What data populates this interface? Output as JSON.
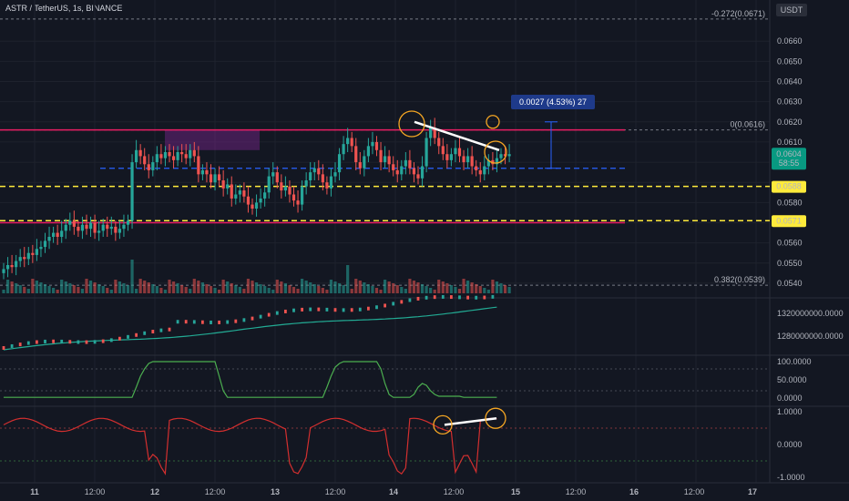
{
  "chart_data": {
    "type": "candlestick",
    "title": "ASTR / TetherUS, 1s, BINANCE",
    "currency": "USDT",
    "price_axis": {
      "ylim": [
        0.0535,
        0.0675
      ],
      "ticks": [
        "0.0660",
        "0.0650",
        "0.0640",
        "0.0630",
        "0.0620",
        "0.0610",
        "0.0580",
        "0.0560",
        "0.0550",
        "0.0540"
      ]
    },
    "current_price": {
      "value": "0.0604",
      "countdown": "58:55",
      "color": "#089981"
    },
    "price_labels": [
      {
        "value": "0.0588",
        "color": "#ffeb3b"
      },
      {
        "value": "0.0571",
        "color": "#ffeb3b"
      }
    ],
    "fib_labels": [
      "-0.272(0.0671)",
      "0(0.0616)",
      "0.382(0.0539)"
    ],
    "measure_label": "0.0027 (4.53%) 27",
    "x_axis": [
      "11",
      "12:00",
      "12",
      "12:00",
      "13",
      "12:00",
      "14",
      "12:00",
      "15",
      "12:00",
      "16",
      "12:00",
      "17"
    ],
    "indicator1": {
      "ticks": [
        "1320000000.0000",
        "1280000000.0000"
      ],
      "color": "#22ab94"
    },
    "indicator2": {
      "ticks": [
        "100.0000",
        "50.0000",
        "0.0000"
      ],
      "color": "#4caf50"
    },
    "indicator3": {
      "ticks": [
        "1.0000",
        "0.0000",
        "-1.0000"
      ],
      "color": "#d32f2f"
    },
    "colors": {
      "up": "#26a69a",
      "down": "#ef5350",
      "resistance": "#e91e63",
      "support": "#ffeb3b",
      "dashed": "#2962ff",
      "highlight": "#f5a623"
    },
    "candle_closes": [
      0.0547,
      0.0549,
      0.0548,
      0.0551,
      0.0553,
      0.0552,
      0.0555,
      0.0554,
      0.0557,
      0.0558,
      0.0561,
      0.0563,
      0.0565,
      0.0563,
      0.0566,
      0.0569,
      0.0571,
      0.0568,
      0.0566,
      0.0569,
      0.0567,
      0.057,
      0.0565,
      0.0566,
      0.0569,
      0.0567,
      0.0568,
      0.0565,
      0.0567,
      0.0569,
      0.0571,
      0.06,
      0.0606,
      0.0603,
      0.0599,
      0.0596,
      0.06,
      0.0604,
      0.0602,
      0.0605,
      0.0603,
      0.0601,
      0.0605,
      0.0604,
      0.0602,
      0.0606,
      0.0603,
      0.0594,
      0.0596,
      0.0594,
      0.059,
      0.0594,
      0.0591,
      0.0587,
      0.0589,
      0.0582,
      0.0584,
      0.0586,
      0.0583,
      0.0579,
      0.0577,
      0.058,
      0.0582,
      0.0585,
      0.0593,
      0.0595,
      0.059,
      0.0586,
      0.0588,
      0.0584,
      0.0581,
      0.0579,
      0.0588,
      0.0591,
      0.0595,
      0.0597,
      0.0594,
      0.059,
      0.0587,
      0.0593,
      0.0595,
      0.0604,
      0.0609,
      0.0612,
      0.0608,
      0.06,
      0.0597,
      0.0603,
      0.0608,
      0.061,
      0.0606,
      0.06,
      0.0603,
      0.0599,
      0.0596,
      0.0594,
      0.0598,
      0.0601,
      0.0597,
      0.0594,
      0.0592,
      0.0598,
      0.0612,
      0.0617,
      0.0612,
      0.0608,
      0.0604,
      0.0601,
      0.0604,
      0.0607,
      0.0603,
      0.06,
      0.0603,
      0.0598,
      0.0596,
      0.0594,
      0.0598,
      0.0601,
      0.0599,
      0.0602,
      0.0604,
      0.0603,
      0.0604
    ]
  }
}
